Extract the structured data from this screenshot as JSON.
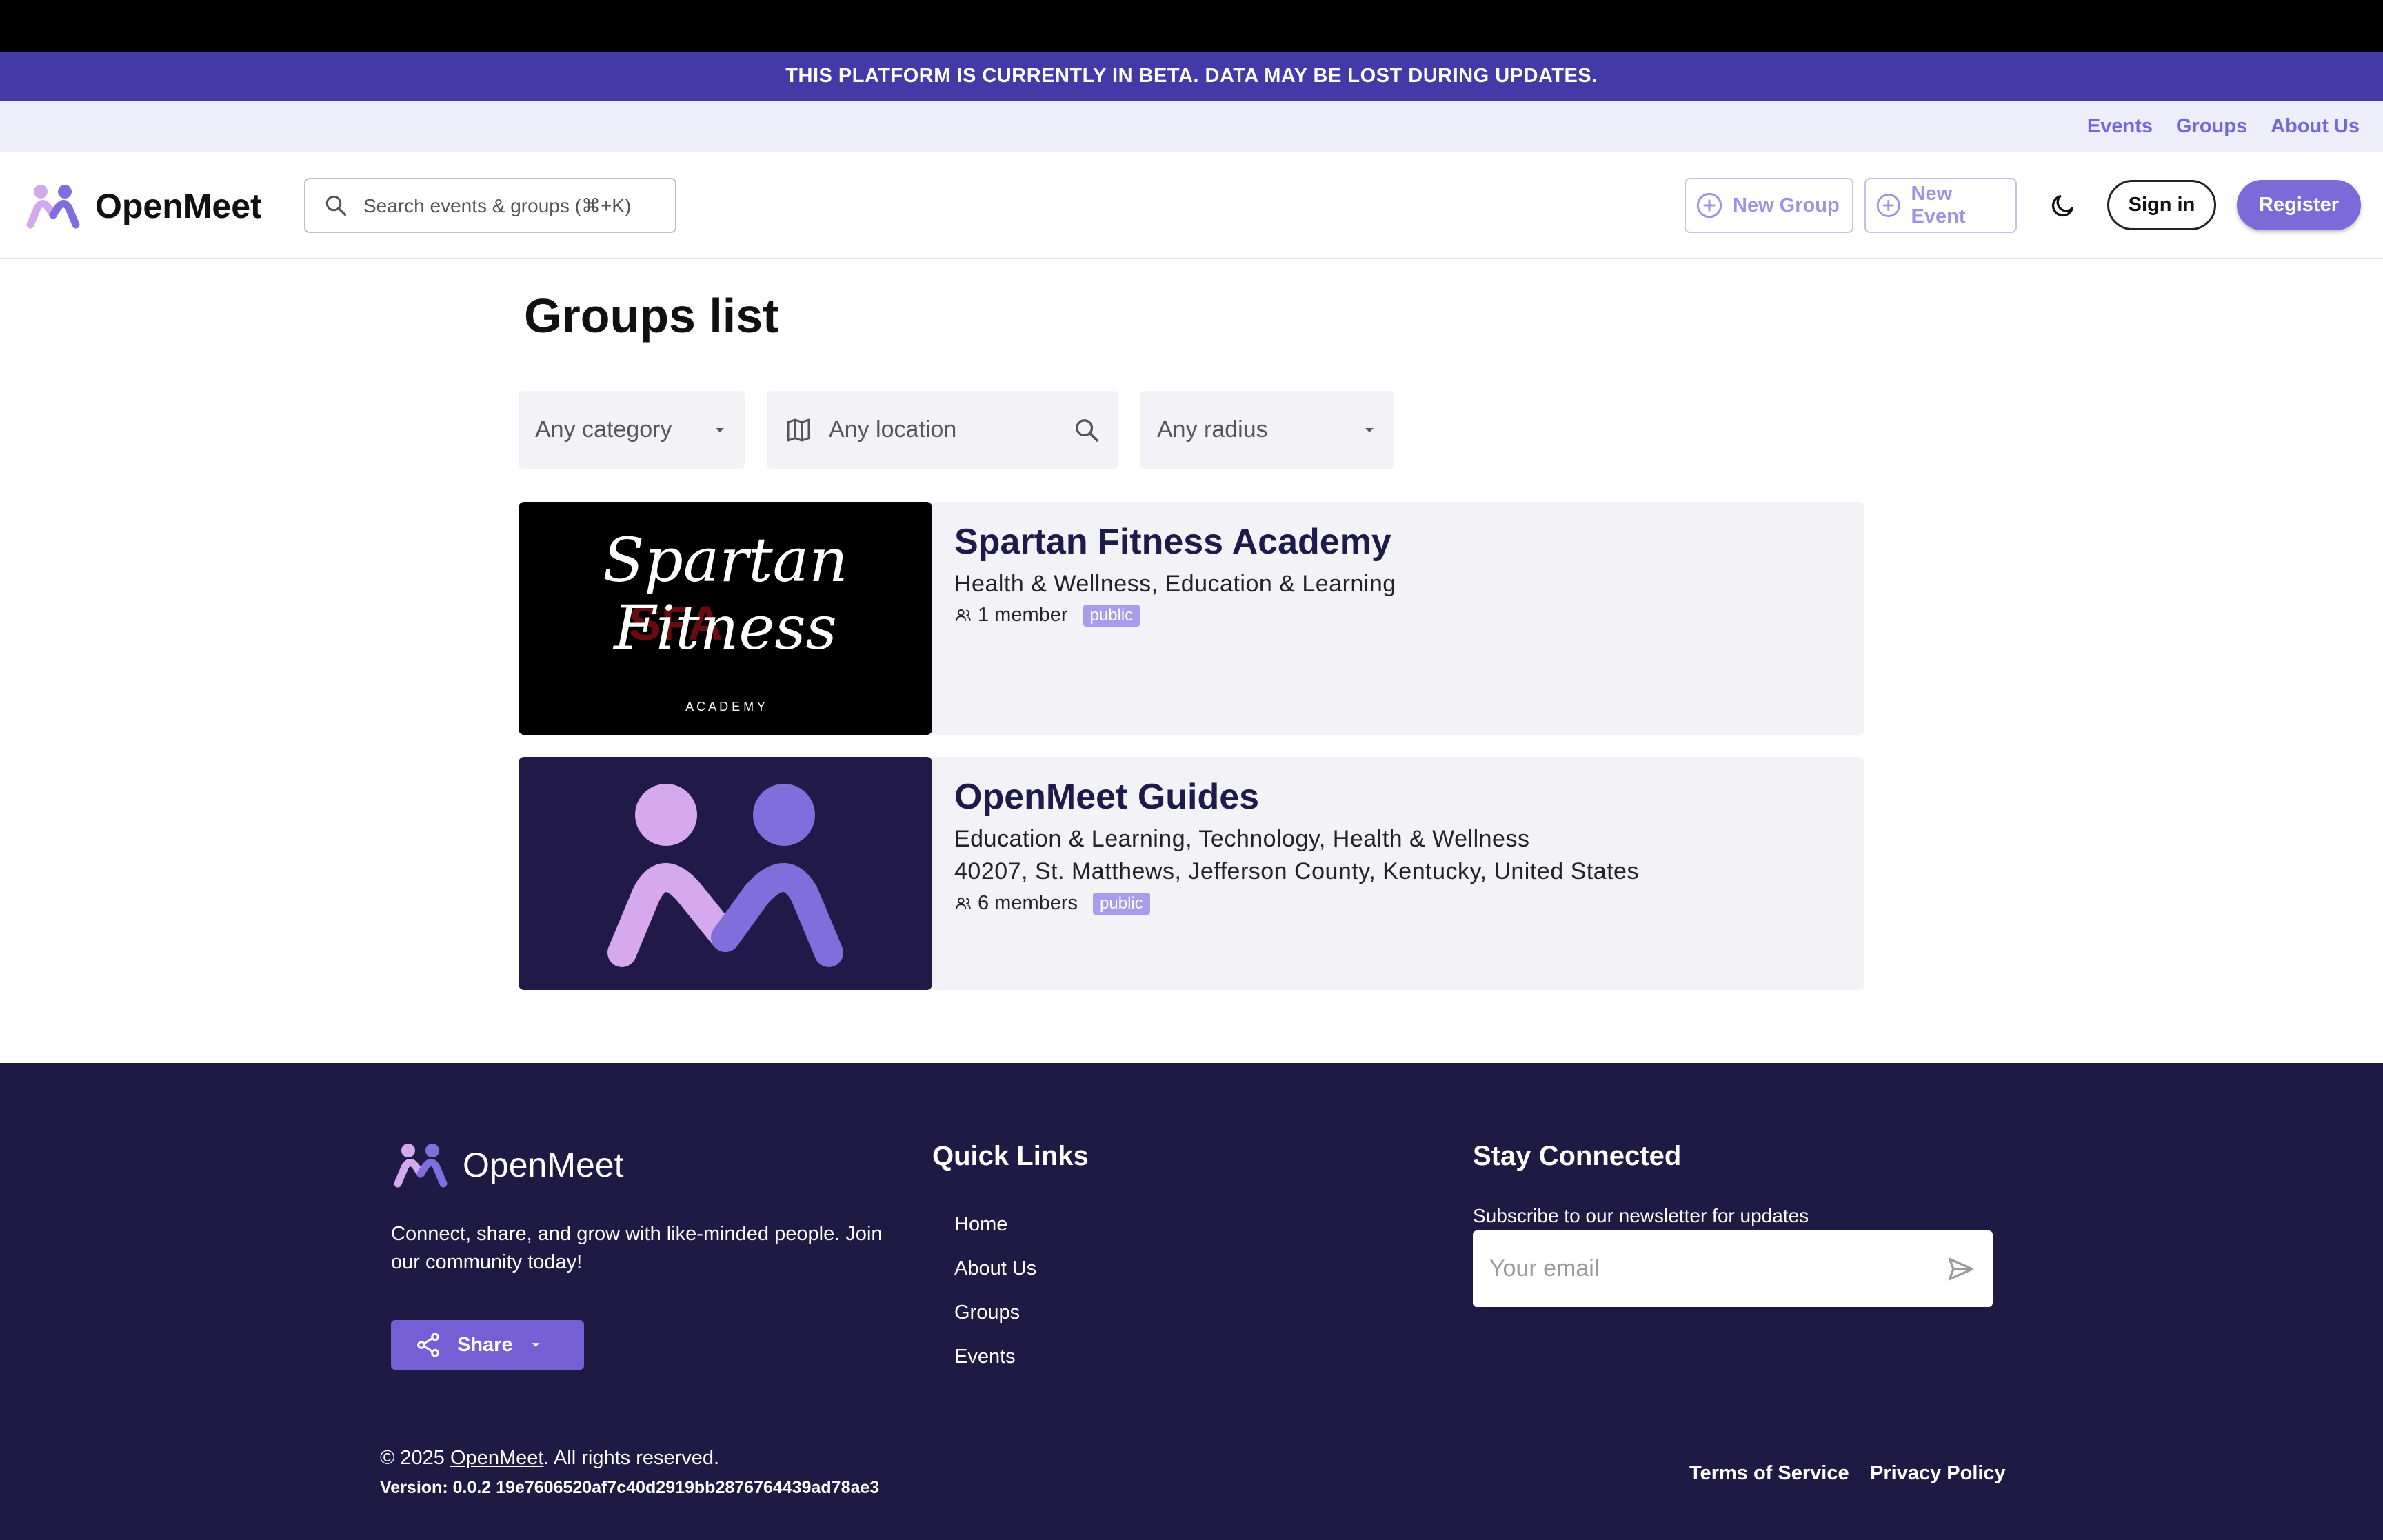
{
  "banner": {
    "text": "THIS PLATFORM IS CURRENTLY IN BETA. DATA MAY BE LOST DURING UPDATES."
  },
  "utility_nav": {
    "items": [
      "Events",
      "Groups",
      "About Us"
    ]
  },
  "header": {
    "logo_text": "OpenMeet",
    "search_placeholder": "Search events & groups (⌘+K)",
    "new_group_label": "New Group",
    "new_event_label": "New Event",
    "sign_in_label": "Sign in",
    "register_label": "Register"
  },
  "main": {
    "title": "Groups list",
    "filters": {
      "category": "Any category",
      "location": "Any location",
      "radius": "Any radius"
    },
    "groups": [
      {
        "name": "Spartan Fitness Academy",
        "categories": "Health & Wellness, Education & Learning",
        "location": "",
        "members": "1 member",
        "visibility": "public",
        "image_text": {
          "line1": "Spartan",
          "line2": "Fitness",
          "line3": "A C A D E M Y",
          "overlay": "SFA"
        }
      },
      {
        "name": "OpenMeet Guides",
        "categories": "Education & Learning, Technology, Health & Wellness",
        "location": "40207, St. Matthews, Jefferson County, Kentucky, United States",
        "members": "6 members",
        "visibility": "public"
      }
    ]
  },
  "footer": {
    "logo_text": "OpenMeet",
    "description": "Connect, share, and grow with like-minded people. Join our community today!",
    "share_label": "Share",
    "quick_links_title": "Quick Links",
    "quick_links": [
      "Home",
      "About Us",
      "Groups",
      "Events"
    ],
    "stay_connected_title": "Stay Connected",
    "newsletter_text": "Subscribe to our newsletter for updates",
    "email_placeholder": "Your email",
    "copyright_prefix": "© 2025 ",
    "copyright_link": "OpenMeet",
    "copyright_suffix": ". All rights reserved.",
    "version": "Version: 0.0.2 19e7606520af7c40d2919bb2876764439ad78ae3",
    "terms_label": "Terms of Service",
    "privacy_label": "Privacy Policy"
  },
  "colors": {
    "banner_bg": "#433aa8",
    "accent": "#7b6ad8",
    "footer_bg": "#1f1a44",
    "badge_bg": "#a99cec",
    "logo_light": "#d2a8ee",
    "logo_dark": "#7f6edb"
  }
}
